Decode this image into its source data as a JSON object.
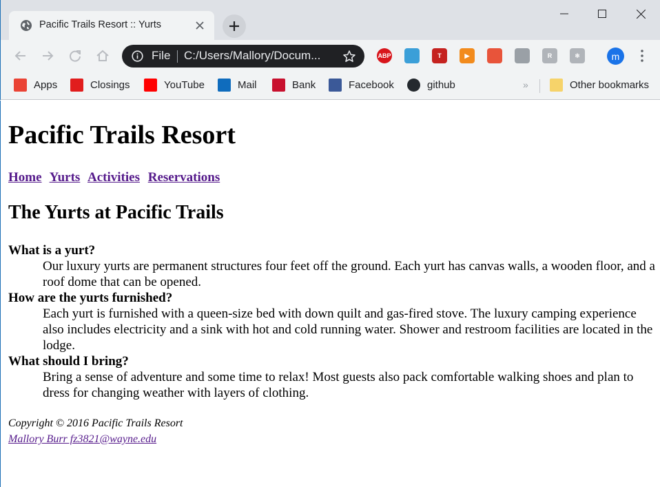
{
  "browser": {
    "tab": {
      "title": "Pacific Trails Resort :: Yurts"
    },
    "omnibox": {
      "scheme_label": "File",
      "url": "C:/Users/Mallory/Docum..."
    },
    "profile_initial": "m",
    "extensions": [
      {
        "name": "adblock-plus-icon",
        "label": "ABP",
        "color": "#d8151b"
      },
      {
        "name": "cast-icon",
        "label": "",
        "color": "#3b9fd8"
      },
      {
        "name": "t-extension-icon",
        "label": "T",
        "color": "#c5221f"
      },
      {
        "name": "play-extension-icon",
        "label": "▶",
        "color": "#f28b1c"
      },
      {
        "name": "office-extension-icon",
        "label": "",
        "color": "#e8543a"
      },
      {
        "name": "pdf-extension-icon",
        "label": "",
        "color": "#9aa0a6"
      },
      {
        "name": "r-extension-icon",
        "label": "R",
        "color": "#b0b4b9"
      },
      {
        "name": "react-devtools-icon",
        "label": "⚛",
        "color": "#b0b4b9"
      }
    ],
    "bookmarks": [
      {
        "name": "apps-icon",
        "label": "Apps",
        "color": "#ea4335"
      },
      {
        "name": "closings-icon",
        "label": "Closings",
        "color": "#e11d1d"
      },
      {
        "name": "youtube-icon",
        "label": "YouTube",
        "color": "#ff0000"
      },
      {
        "name": "mail-icon",
        "label": "Mail",
        "color": "#0f6cbd"
      },
      {
        "name": "bank-icon",
        "label": "Bank",
        "color": "#c8102e"
      },
      {
        "name": "facebook-icon",
        "label": "Facebook",
        "color": "#3b5998"
      },
      {
        "name": "github-icon",
        "label": "github",
        "color": "#24292e"
      }
    ],
    "more_bookmarks": "»",
    "other_bookmarks": "Other bookmarks"
  },
  "page": {
    "title": "Pacific Trails Resort",
    "nav": [
      "Home",
      "Yurts",
      "Activities",
      "Reservations"
    ],
    "heading": "The Yurts at Pacific Trails",
    "faq": [
      {
        "q": "What is a yurt?",
        "a": "Our luxury yurts are permanent structures four feet off the ground. Each yurt has canvas walls, a wooden floor, and a roof dome that can be opened."
      },
      {
        "q": "How are the yurts furnished?",
        "a": "Each yurt is furnished with a queen-size bed with down quilt and gas-fired stove. The luxury camping experience also includes electricity and a sink with hot and cold running water. Shower and restroom facilities are located in the lodge."
      },
      {
        "q": "What should I bring?",
        "a": "Bring a sense of adventure and some time to relax! Most guests also pack comfortable walking shoes and plan to dress for changing weather with layers of clothing."
      }
    ],
    "footer": {
      "copyright": "Copyright © 2016 Pacific Trails Resort",
      "contact": "Mallory Burr fz3821@wayne.edu"
    }
  }
}
